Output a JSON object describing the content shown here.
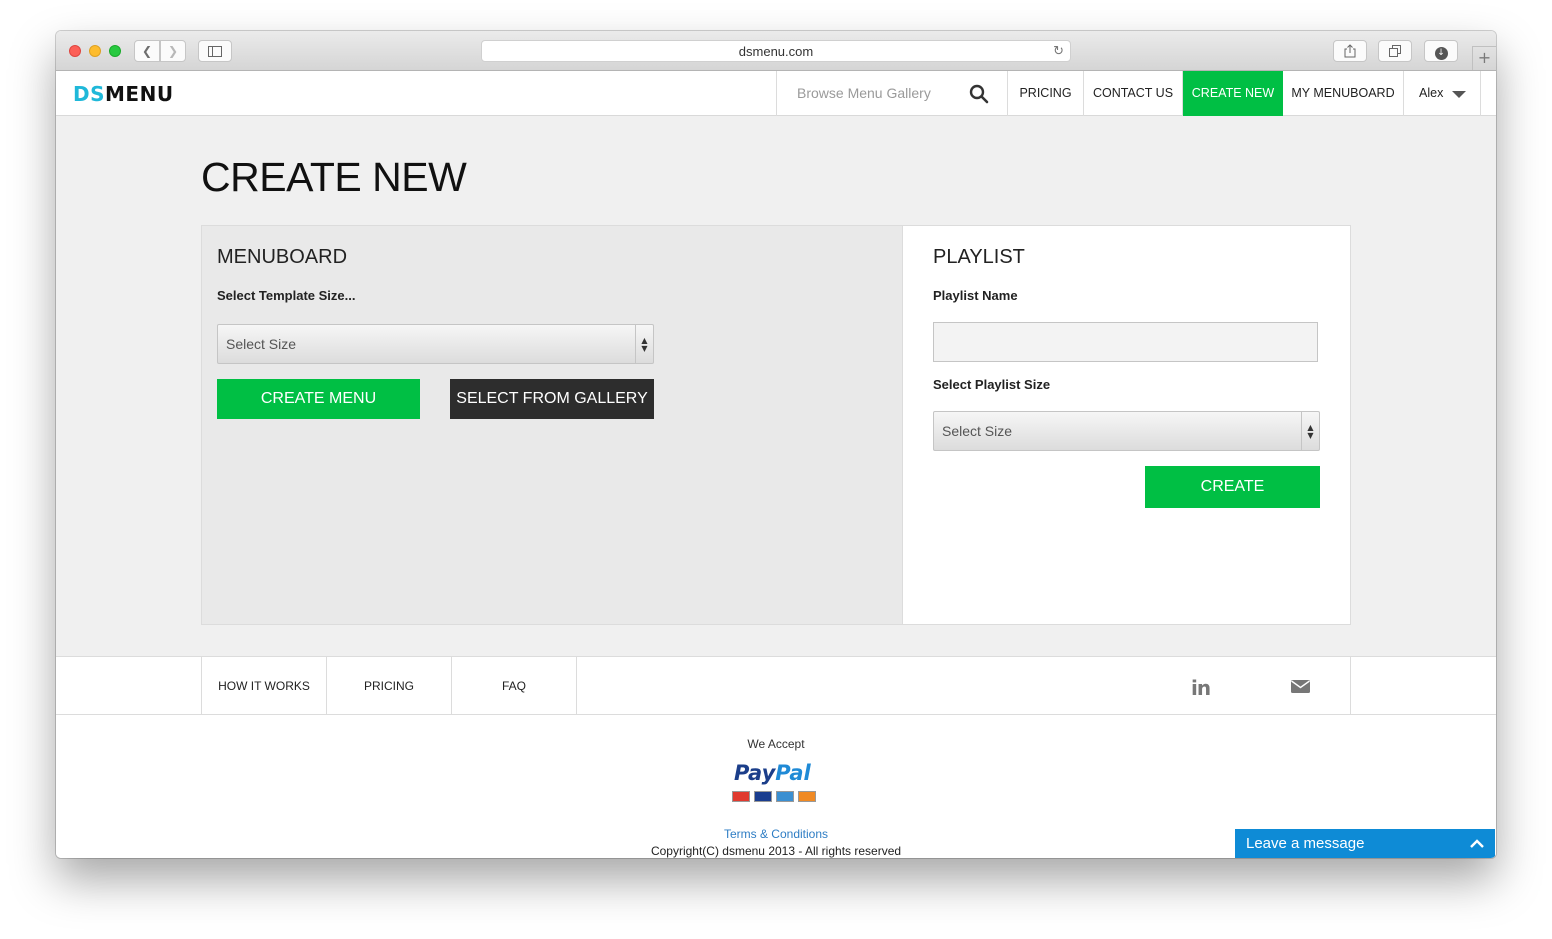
{
  "browser": {
    "url": "dsmenu.com"
  },
  "header": {
    "logo_part1": "DS",
    "logo_part2": "MENU",
    "search_placeholder": "Browse Menu Gallery",
    "nav": {
      "pricing": "PRICING",
      "contact": "CONTACT US",
      "create_new": "CREATE NEW",
      "my_menuboard": "MY MENUBOARD",
      "user": "Alex"
    }
  },
  "page": {
    "title": "CREATE NEW"
  },
  "menuboard": {
    "heading": "MENUBOARD",
    "template_label": "Select Template Size...",
    "size_select": "Select Size",
    "create_button": "CREATE MENU",
    "gallery_button": "SELECT FROM GALLERY"
  },
  "playlist": {
    "heading": "PLAYLIST",
    "name_label": "Playlist Name",
    "name_value": "",
    "size_label": "Select Playlist Size",
    "size_select": "Select Size",
    "create_button": "CREATE"
  },
  "footer_nav": {
    "how_it_works": "HOW IT WORKS",
    "pricing": "PRICING",
    "faq": "FAQ",
    "social_icons": [
      "linkedin-icon",
      "mail-icon"
    ]
  },
  "footer": {
    "we_accept": "We Accept",
    "paypal_pay": "Pay",
    "paypal_pal": "Pal",
    "terms": "Terms & Conditions",
    "copyright": "Copyright(C) dsmenu 2013 - All rights reserved"
  },
  "chat": {
    "label": "Leave a message"
  },
  "colors": {
    "brand_accent": "#00bf44",
    "logo_cyan": "#1fb8d9",
    "chat_blue": "#0e8bd6"
  }
}
